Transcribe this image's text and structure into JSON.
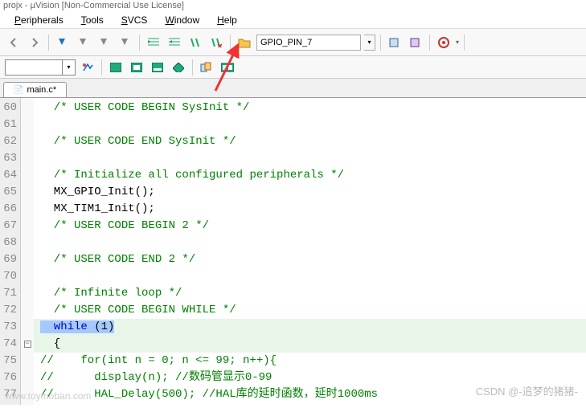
{
  "title_fragment": "projx - µVision [Non-Commercial Use License]",
  "menus": {
    "peripherals": "Peripherals",
    "tools": "Tools",
    "svcs": "SVCS",
    "window": "Window",
    "help": "Help"
  },
  "toolbar": {
    "search_value": "GPIO_PIN_7"
  },
  "tab": {
    "name": "main.c*"
  },
  "gutter_start": 60,
  "code_lines": [
    {
      "type": "comment",
      "text": "  /* USER CODE BEGIN SysInit */"
    },
    {
      "type": "blank",
      "text": ""
    },
    {
      "type": "comment",
      "text": "  /* USER CODE END SysInit */"
    },
    {
      "type": "blank",
      "text": ""
    },
    {
      "type": "comment",
      "text": "  /* Initialize all configured peripherals */"
    },
    {
      "type": "plain",
      "text": "  MX_GPIO_Init();"
    },
    {
      "type": "plain",
      "text": "  MX_TIM1_Init();"
    },
    {
      "type": "comment",
      "text": "  /* USER CODE BEGIN 2 */"
    },
    {
      "type": "blank",
      "text": ""
    },
    {
      "type": "comment",
      "text": "  /* USER CODE END 2 */"
    },
    {
      "type": "blank",
      "text": ""
    },
    {
      "type": "comment",
      "text": "  /* Infinite loop */"
    },
    {
      "type": "comment",
      "text": "  /* USER CODE BEGIN WHILE */"
    },
    {
      "type": "while",
      "hl": true,
      "pre": "  ",
      "kw": "while",
      "rest": " (1)"
    },
    {
      "type": "plain",
      "hl": true,
      "text": "  {"
    },
    {
      "type": "comment",
      "text": "//    for(int n = 0; n <= 99; n++){"
    },
    {
      "type": "comment",
      "text": "//      display(n); //数码管显示0-99"
    },
    {
      "type": "comment",
      "text": "//      HAL_Delay(500); //HAL库的延时函数，延时1000ms"
    }
  ],
  "watermarks": {
    "left": "www.toymoban.com",
    "right": "CSDN @-追梦的猪猪-"
  }
}
